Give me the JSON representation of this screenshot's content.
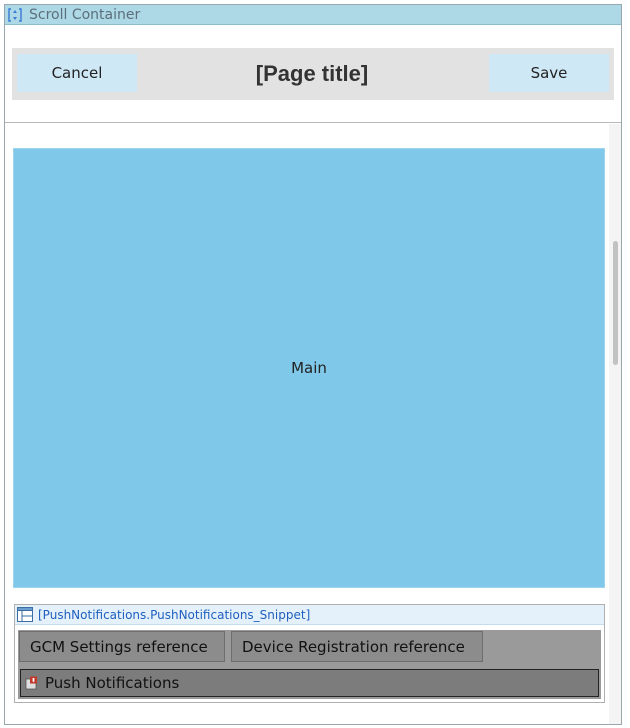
{
  "scroll_container": {
    "icon": "scroll-container-icon",
    "label": "Scroll Container"
  },
  "header": {
    "cancel_label": "Cancel",
    "title": "[Page title]",
    "save_label": "Save"
  },
  "main": {
    "label": "Main"
  },
  "snippet": {
    "icon": "web-block-icon",
    "title": "[PushNotifications.PushNotifications_Snippet]",
    "references": [
      {
        "label": "GCM Settings reference"
      },
      {
        "label": "Device Registration reference"
      }
    ],
    "push": {
      "icon": "push-notifications-icon",
      "label": "Push Notifications"
    }
  },
  "colors": {
    "container_header": "#add8e6",
    "button_bg": "#cfe8f6",
    "title_bar": "#e2e2e2",
    "main_bg": "#80c8ea",
    "snippet_title": "#1f5fbf"
  }
}
